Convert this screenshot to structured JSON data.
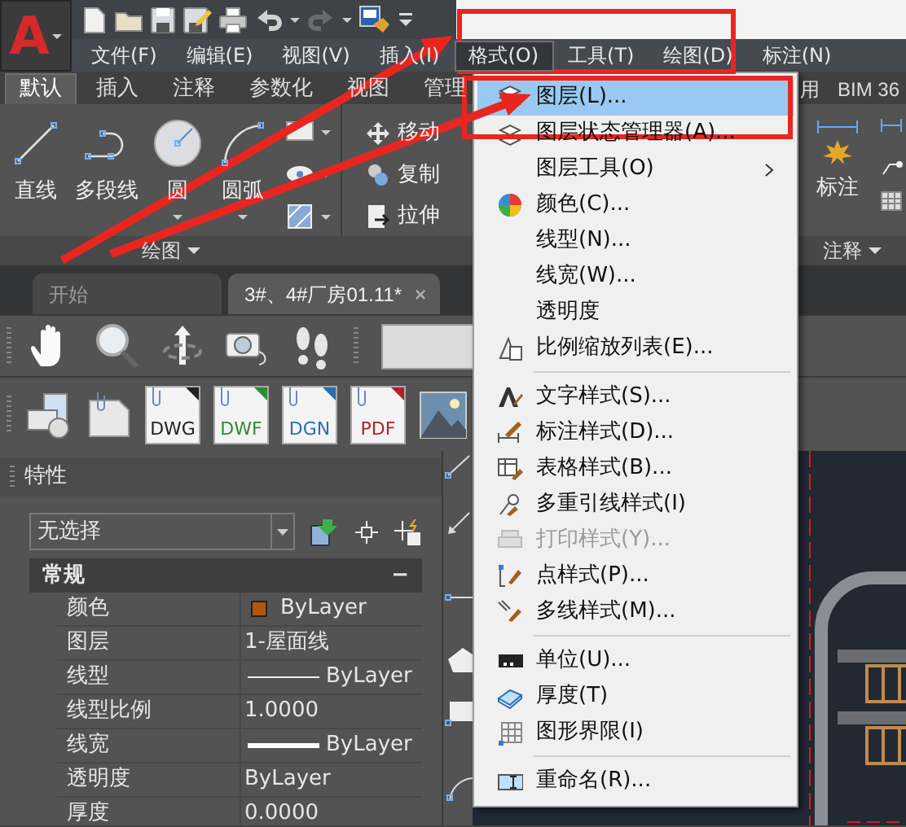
{
  "logo": "A",
  "menu_bar": [
    {
      "label": "文件(F)",
      "selected": false
    },
    {
      "label": "编辑(E)",
      "selected": false
    },
    {
      "label": "视图(V)",
      "selected": false
    },
    {
      "label": "插入(I)",
      "selected": false
    },
    {
      "label": "格式(O)",
      "selected": true
    },
    {
      "label": "工具(T)",
      "selected": false
    },
    {
      "label": "绘图(D)",
      "selected": false
    },
    {
      "label": "标注(N)",
      "selected": false
    }
  ],
  "ribbon": {
    "tabs": [
      {
        "label": "默认",
        "selected": true
      },
      {
        "label": "插入",
        "selected": false
      },
      {
        "label": "注释",
        "selected": false
      },
      {
        "label": "参数化",
        "selected": false
      },
      {
        "label": "视图",
        "selected": false
      },
      {
        "label": "管理",
        "selected": false
      },
      {
        "label": "用",
        "selected": false
      },
      {
        "label": "BIM 36",
        "selected": false
      }
    ],
    "draw_tools": [
      {
        "label": "直线"
      },
      {
        "label": "多段线"
      },
      {
        "label": "圆"
      },
      {
        "label": "圆弧"
      }
    ],
    "modify_tools": [
      {
        "label": "移动"
      },
      {
        "label": "复制"
      },
      {
        "label": "拉伸"
      }
    ],
    "annotation_tools": [
      {
        "label": "标注"
      }
    ],
    "panels": [
      {
        "label": "绘图"
      },
      {
        "label": "注释"
      }
    ]
  },
  "document_tabs": [
    {
      "label": "开始",
      "selected": false
    },
    {
      "label": "3#、4#厂房01.11*",
      "selected": true,
      "close": "×"
    }
  ],
  "attach_formats": [
    {
      "label": "DWG",
      "color": "#222222"
    },
    {
      "label": "DWF",
      "color": "#2e8b3a"
    },
    {
      "label": "DGN",
      "color": "#2a6db5"
    },
    {
      "label": "PDF",
      "color": "#b0202a"
    }
  ],
  "properties": {
    "title": "特性",
    "selection": "无选择",
    "section": {
      "label": "常规",
      "toggle": "−"
    },
    "rows": [
      {
        "label": "颜色",
        "kind": "color",
        "value": "ByLayer",
        "color": "#b4560c"
      },
      {
        "label": "图层",
        "kind": "text",
        "value": "1-屋面线"
      },
      {
        "label": "线型",
        "kind": "line",
        "value": "ByLayer"
      },
      {
        "label": "线型比例",
        "kind": "text",
        "value": "1.0000"
      },
      {
        "label": "线宽",
        "kind": "thick-line",
        "value": "ByLayer"
      },
      {
        "label": "透明度",
        "kind": "text",
        "value": "ByLayer"
      },
      {
        "label": "厚度",
        "kind": "text",
        "value": "0.0000"
      }
    ]
  },
  "format_menu": {
    "items": [
      {
        "kind": "item",
        "label": "图层(L)...",
        "selected": true,
        "disabled": false,
        "submenu": false
      },
      {
        "kind": "item",
        "label": "图层状态管理器(A)...",
        "selected": false,
        "disabled": false,
        "submenu": false
      },
      {
        "kind": "item",
        "label": "图层工具(O)",
        "selected": false,
        "disabled": false,
        "submenu": true
      },
      {
        "kind": "item",
        "label": "颜色(C)...",
        "selected": false,
        "disabled": false,
        "submenu": false
      },
      {
        "kind": "item",
        "label": "线型(N)...",
        "selected": false,
        "disabled": false,
        "submenu": false
      },
      {
        "kind": "item",
        "label": "线宽(W)...",
        "selected": false,
        "disabled": false,
        "submenu": false
      },
      {
        "kind": "item",
        "label": "透明度",
        "selected": false,
        "disabled": false,
        "submenu": false
      },
      {
        "kind": "item",
        "label": "比例缩放列表(E)...",
        "selected": false,
        "disabled": false,
        "submenu": false
      },
      {
        "kind": "separator"
      },
      {
        "kind": "item",
        "label": "文字样式(S)...",
        "selected": false,
        "disabled": false,
        "submenu": false
      },
      {
        "kind": "item",
        "label": "标注样式(D)...",
        "selected": false,
        "disabled": false,
        "submenu": false
      },
      {
        "kind": "item",
        "label": "表格样式(B)...",
        "selected": false,
        "disabled": false,
        "submenu": false
      },
      {
        "kind": "item",
        "label": "多重引线样式(I)",
        "selected": false,
        "disabled": false,
        "submenu": false
      },
      {
        "kind": "item",
        "label": "打印样式(Y)...",
        "selected": false,
        "disabled": true,
        "submenu": false
      },
      {
        "kind": "item",
        "label": "点样式(P)...",
        "selected": false,
        "disabled": false,
        "submenu": false
      },
      {
        "kind": "item",
        "label": "多线样式(M)...",
        "selected": false,
        "disabled": false,
        "submenu": false
      },
      {
        "kind": "separator"
      },
      {
        "kind": "item",
        "label": "单位(U)...",
        "selected": false,
        "disabled": false,
        "submenu": false
      },
      {
        "kind": "item",
        "label": "厚度(T)",
        "selected": false,
        "disabled": false,
        "submenu": false
      },
      {
        "kind": "item",
        "label": "图形界限(I)",
        "selected": false,
        "disabled": false,
        "submenu": false
      },
      {
        "kind": "separator"
      },
      {
        "kind": "item",
        "label": "重命名(R)...",
        "selected": false,
        "disabled": false,
        "submenu": false
      }
    ]
  }
}
